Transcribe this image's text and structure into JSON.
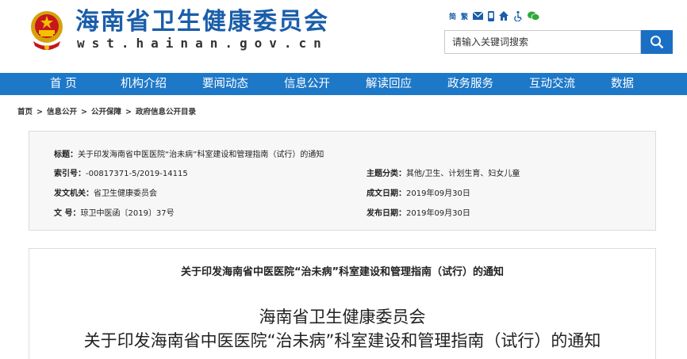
{
  "header": {
    "site_name": "海南省卫生健康委员会",
    "site_url": "wst.hainan.gov.cn",
    "quick_links": {
      "simplified": "简",
      "traditional": "繁"
    },
    "search": {
      "placeholder": "请输入关键词搜索"
    },
    "colors": {
      "brand": "#1a5ea9",
      "search_button": "#1a6fc4",
      "wechat": "#2eaa3a"
    }
  },
  "nav": {
    "color": "#1e78c8",
    "items": [
      "首 页",
      "机构介绍",
      "要闻动态",
      "信息公开",
      "解读回应",
      "政务服务",
      "互动交流",
      "数据"
    ]
  },
  "breadcrumb": [
    "首页",
    "信息公开",
    "公开保障",
    "政府信息公开目录"
  ],
  "meta": {
    "title_label": "标题：",
    "title_value": "关于印发海南省中医医院“治未病”科室建设和管理指南（试行）的通知",
    "index_label": "索引号：",
    "index_value": "-00817371-5/2019-14115",
    "subject_label": "主题分类：",
    "subject_value": "其他/卫生、计划生育、妇女儿童",
    "issuer_label": "发文机关：",
    "issuer_value": "省卫生健康委员会",
    "written_label": "成文日期：",
    "written_value": "2019年09月30日",
    "docno_label": "文 号：",
    "docno_value": "琼卫中医函〔2019〕37号",
    "published_label": "发布日期：",
    "published_value": "2019年09月30日"
  },
  "document": {
    "heading": "关于印发海南省中医医院“治未病”科室建设和管理指南（试行）的通知",
    "issuer": "海南省卫生健康委员会",
    "title": "关于印发海南省中医医院“治未病”科室建设和管理指南（试行）的通知"
  }
}
